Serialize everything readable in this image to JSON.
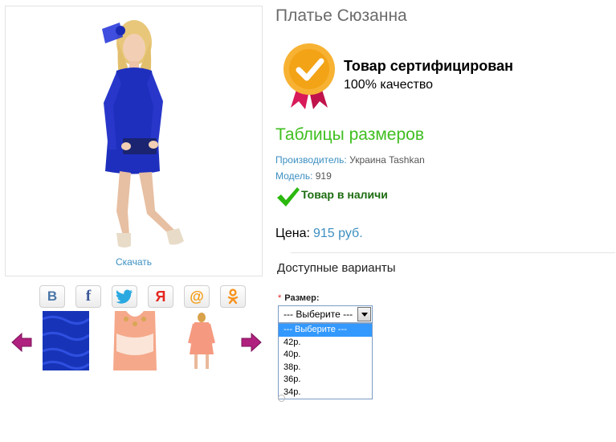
{
  "product": {
    "title": "Платье Сюзанна",
    "download_link": "Скачать",
    "certificate": {
      "title": "Товар сертифицирован",
      "subtitle": "100% качество"
    },
    "size_table_link": "Таблицы размеров",
    "manufacturer": {
      "label": "Производитель:",
      "value": "Украина Tashkan"
    },
    "model": {
      "label": "Модель:",
      "value": "919"
    },
    "stock_status": "Товар в наличи",
    "price": {
      "label": "Цена:",
      "value": "915 руб."
    },
    "colors": {
      "accent_green": "#3fbf1f",
      "link_blue": "#3c8fc1",
      "dress_blue": "#1e2fbe",
      "stock_green": "#1c6d10"
    }
  },
  "share": [
    {
      "name": "vk",
      "glyph": "В",
      "color": "#4a76a8"
    },
    {
      "name": "facebook",
      "glyph": "f",
      "color": "#3b5998"
    },
    {
      "name": "twitter",
      "glyph": "bird",
      "color": "#2aa9e0"
    },
    {
      "name": "yandex",
      "glyph": "Я",
      "color": "#e52620"
    },
    {
      "name": "mail",
      "glyph": "@",
      "color": "#f39c12"
    },
    {
      "name": "odnoklassniki",
      "glyph": "ok",
      "color": "#f7931e"
    }
  ],
  "gallery": {
    "thumbnails": [
      "blue-lace-closeup",
      "peach-dress-top",
      "peach-dress-back"
    ]
  },
  "variants": {
    "title": "Доступные варианты",
    "size_label": "Размер:",
    "required_marker": "*",
    "selected": "--- Выберите ---",
    "options": [
      "--- Выберите ---",
      "42р.",
      "40р.",
      "38р.",
      "36р.",
      "34р."
    ]
  }
}
